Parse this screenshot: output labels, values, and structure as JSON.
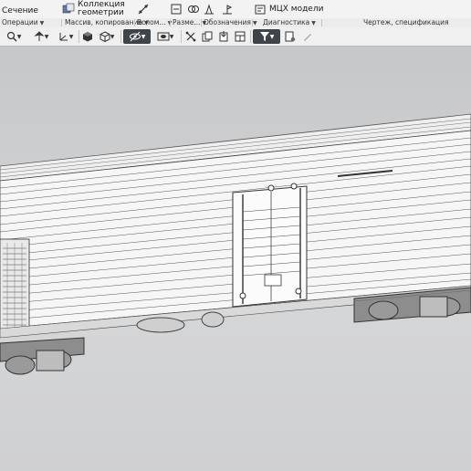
{
  "ribbon": {
    "section_label": "Сечение",
    "collection_label_line1": "Коллекция",
    "collection_label_line2": "геометрии",
    "mcx_label": "МЦХ модели"
  },
  "groups": [
    {
      "label": "Операции"
    },
    {
      "label": "Массив, копирование"
    },
    {
      "label": "Вспом..."
    },
    {
      "label": "Разме..."
    },
    {
      "label": "Обозначения"
    },
    {
      "label": "Диагностика"
    },
    {
      "label": "Чертеж, спецификация"
    }
  ],
  "toolbar_icons": [
    "zoom-icon",
    "orient-icon",
    "axes-icon",
    "shaded-icon",
    "view-cube-icon",
    "hide-icon",
    "display-mode-icon",
    "section-view-icon",
    "copy-icon",
    "filter-icon",
    "settings-icon",
    "pen-icon"
  ],
  "colors": {
    "active_tool": "#3f4448",
    "background": "#c8c9cb"
  }
}
